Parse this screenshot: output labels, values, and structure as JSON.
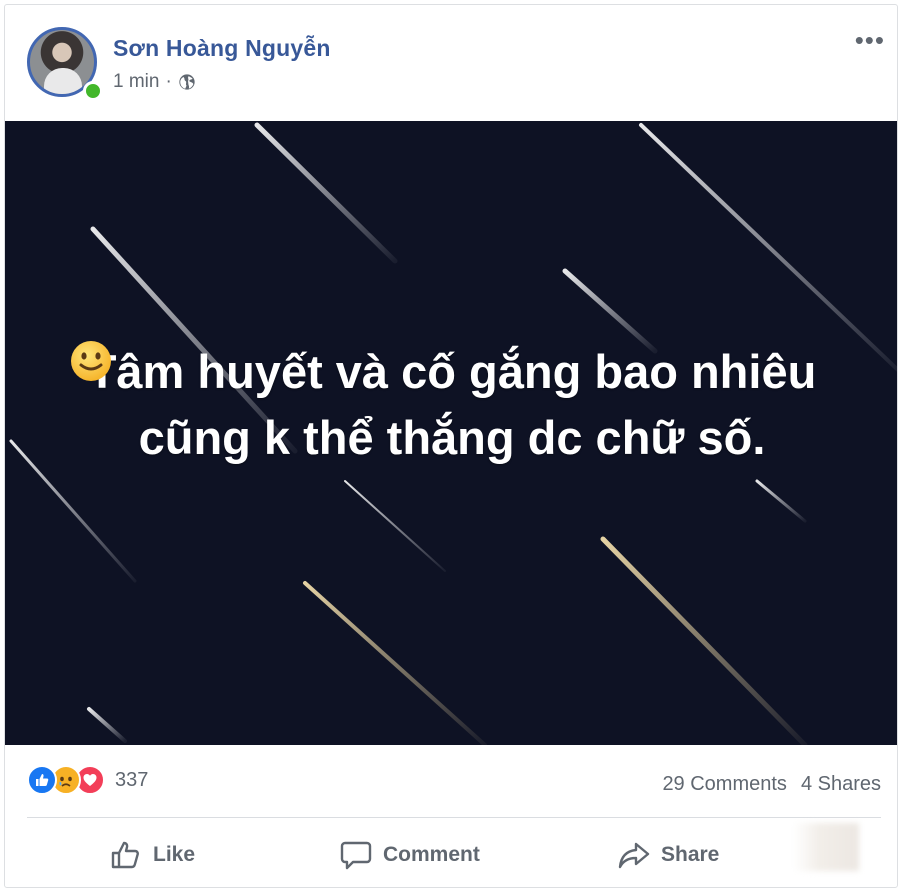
{
  "post": {
    "author": "Sơn Hoàng Nguyễn",
    "time": "1 min",
    "separator": "·",
    "privacy_icon": "globe-icon",
    "more_icon": "more-dots-icon",
    "more_label": "•••"
  },
  "photo": {
    "caption": "Tâm huyết và cố gắng bao nhiêu cũng k thể thắng dc chữ số.",
    "emoji": "slightly-smiling-face",
    "background": "#0e1224"
  },
  "stats": {
    "reactions": [
      "like",
      "sad",
      "love"
    ],
    "reaction_count": "337",
    "comments": "29 Comments",
    "shares": "4 Shares"
  },
  "actions": {
    "like": "Like",
    "comment": "Comment",
    "share": "Share"
  },
  "colors": {
    "author": "#385898",
    "muted": "#606770",
    "like_blue": "#1877f2",
    "love_red": "#f33e58",
    "sad_yellow": "#f7b125",
    "online_green": "#42b72a"
  }
}
